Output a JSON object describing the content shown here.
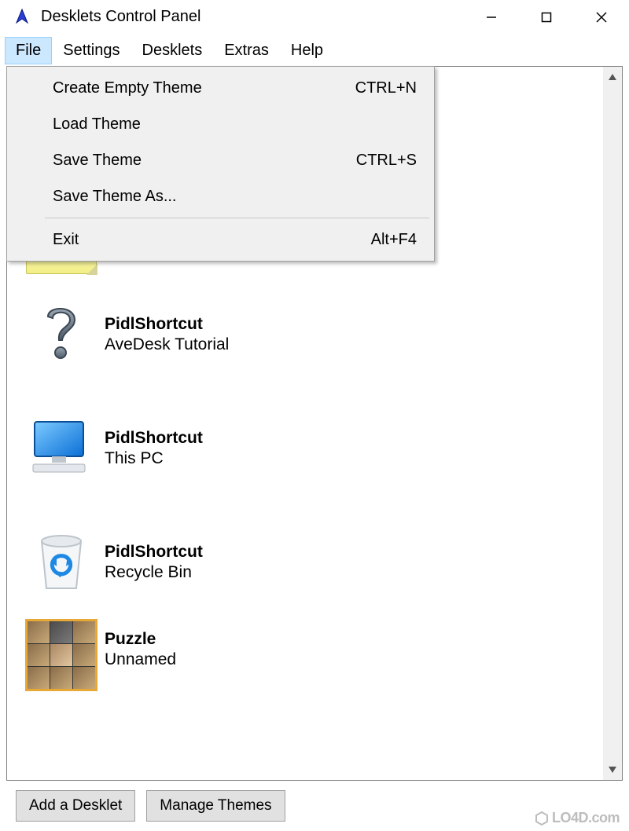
{
  "window": {
    "title": "Desklets Control Panel"
  },
  "menubar": {
    "items": [
      {
        "label": "File",
        "active": true
      },
      {
        "label": "Settings",
        "active": false
      },
      {
        "label": "Desklets",
        "active": false
      },
      {
        "label": "Extras",
        "active": false
      },
      {
        "label": "Help",
        "active": false
      }
    ]
  },
  "file_menu": {
    "items": [
      {
        "label": "Create Empty Theme",
        "shortcut": "CTRL+N"
      },
      {
        "label": "Load Theme",
        "shortcut": ""
      },
      {
        "label": "Save Theme",
        "shortcut": "CTRL+S"
      },
      {
        "label": "Save Theme As...",
        "shortcut": ""
      }
    ],
    "exit": {
      "label": "Exit",
      "shortcut": "Alt+F4"
    }
  },
  "desklets": [
    {
      "title": "",
      "subtitle": "",
      "icon": "sticky-note"
    },
    {
      "title": "PidlShortcut",
      "subtitle": "AveDesk Tutorial",
      "icon": "question"
    },
    {
      "title": "PidlShortcut",
      "subtitle": "This PC",
      "icon": "monitor"
    },
    {
      "title": "PidlShortcut",
      "subtitle": "Recycle Bin",
      "icon": "recycle-bin"
    },
    {
      "title": "Puzzle",
      "subtitle": "Unnamed",
      "icon": "puzzle"
    }
  ],
  "buttons": {
    "add": "Add a Desklet",
    "manage": "Manage Themes"
  },
  "watermark": "LO4D.com"
}
